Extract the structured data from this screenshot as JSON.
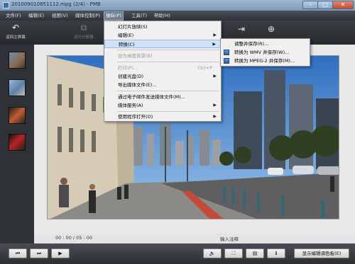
{
  "window": {
    "title": "201009010851112.mpg (2/4) - PMB"
  },
  "menubar": {
    "items": [
      {
        "label": "文件(F)"
      },
      {
        "label": "编辑(E)"
      },
      {
        "label": "视图(V)"
      },
      {
        "label": "媒体控制(P)"
      },
      {
        "label": "操纵(P)"
      },
      {
        "label": "工具(T)"
      },
      {
        "label": "帮助(H)"
      }
    ]
  },
  "toolbar": {
    "back_label": "返回主屏幕",
    "dim_label": "运行分割器"
  },
  "manipulate_menu": {
    "items": [
      {
        "label": "幻灯片放映(S)"
      },
      {
        "label": "编辑(E)"
      },
      {
        "label": "转换(C)"
      },
      {
        "label": "设为桌面背景(B)"
      },
      {
        "label": "打印(P)...",
        "shortcut": "Ctrl+P"
      },
      {
        "label": "创建光盘(D)"
      },
      {
        "label": "导出媒体文件(E)..."
      },
      {
        "label": "通过电子邮件发送媒体文件(M)..."
      },
      {
        "label": "媒体服务(A)"
      },
      {
        "label": "使用程序打开(O)"
      }
    ]
  },
  "convert_submenu": {
    "items": [
      {
        "label": "调整并保存(R)..."
      },
      {
        "label": "转换为 WMV 并保存(W)..."
      },
      {
        "label": "转换为 MPEG-2 并保存(M)..."
      }
    ]
  },
  "player": {
    "time": "00 : 00  /  05 : 00",
    "note": "输入注释"
  },
  "controls": {
    "edit_palette_label": "显示编辑调色板(E)"
  },
  "icons": {
    "back": "back-arrow-icon",
    "export": "export-icon",
    "globe": "globe-icon",
    "prev": "prev-icon",
    "next": "next-icon",
    "play": "play-icon",
    "volume": "volume-icon",
    "fit": "fit-screen-icon",
    "filmstrip": "filmstrip-icon",
    "info": "info-icon"
  }
}
